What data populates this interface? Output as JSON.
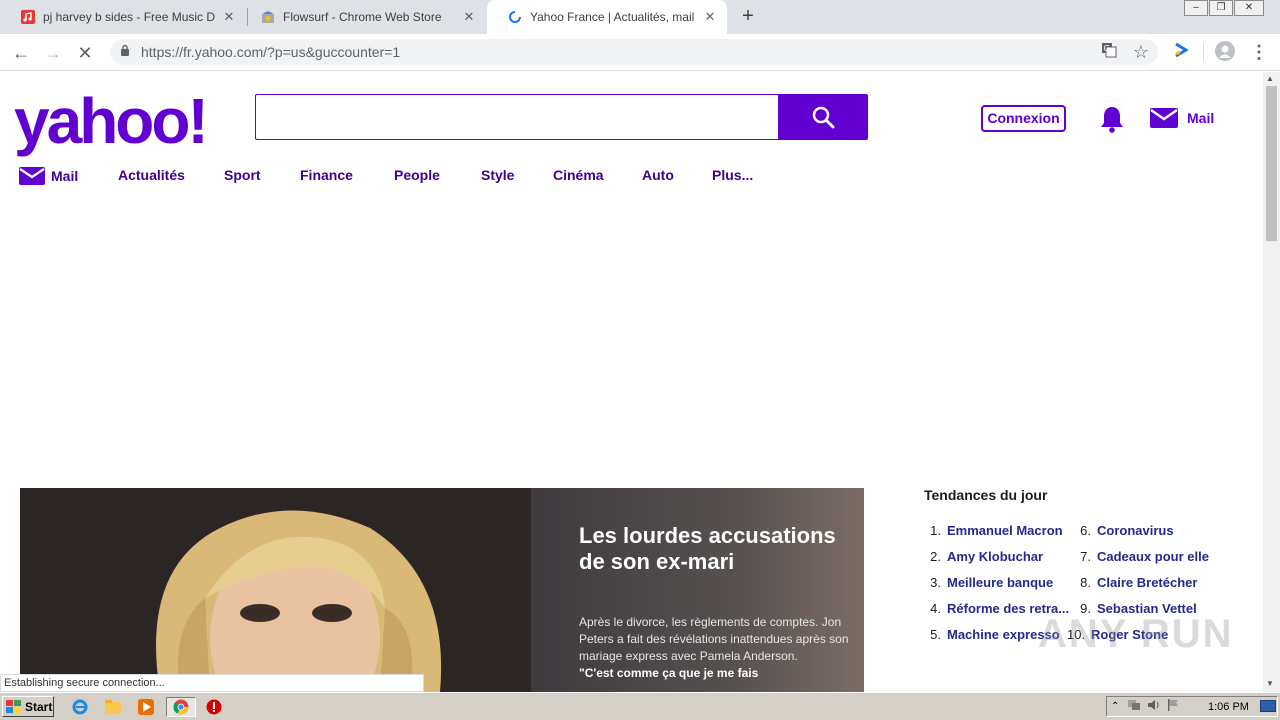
{
  "browser": {
    "tabs": [
      {
        "title": "pj harvey b sides - Free Music Downl",
        "icon": "music-note-icon",
        "active": false
      },
      {
        "title": "Flowsurf - Chrome Web Store",
        "icon": "chrome-store-icon",
        "active": false
      },
      {
        "title": "Yahoo France | Actualités, mail et re",
        "icon": "loading-spinner-icon",
        "active": true
      }
    ],
    "url": "https://fr.yahoo.com/?p=us&guccounter=1",
    "status": "Establishing secure connection..."
  },
  "yahoo": {
    "logo": "yahoo!",
    "search": {
      "value": "",
      "placeholder": ""
    },
    "connexion_label": "Connexion",
    "mail_label": "Mail",
    "brand_color": "#6001d2",
    "nav": [
      "Mail",
      "Actualités",
      "Sport",
      "Finance",
      "People",
      "Style",
      "Cinéma",
      "Auto",
      "Plus..."
    ],
    "hero": {
      "title": "Les lourdes accusations de son ex-mari",
      "body": "Après le divorce, les règlements de comptes. Jon Peters a fait des révélations inattendues après son mariage express avec Pamela Anderson.",
      "quote": "\"C'est comme ça que je me fais"
    },
    "trending": {
      "title": "Tendances du jour",
      "items": [
        {
          "num": "1.",
          "label": "Emmanuel Macron"
        },
        {
          "num": "2.",
          "label": "Amy Klobuchar"
        },
        {
          "num": "3.",
          "label": "Meilleure banque"
        },
        {
          "num": "4.",
          "label": "Réforme des retra..."
        },
        {
          "num": "5.",
          "label": "Machine expresso"
        },
        {
          "num": "6.",
          "label": "Coronavirus"
        },
        {
          "num": "7.",
          "label": "Cadeaux pour elle"
        },
        {
          "num": "8.",
          "label": "Claire Bretécher"
        },
        {
          "num": "9.",
          "label": "Sebastian Vettel"
        },
        {
          "num": "10.",
          "label": "Roger Stone"
        }
      ]
    }
  },
  "watermark": "ANY RUN",
  "taskbar": {
    "start_label": "Start",
    "clock": "1:06 PM"
  }
}
